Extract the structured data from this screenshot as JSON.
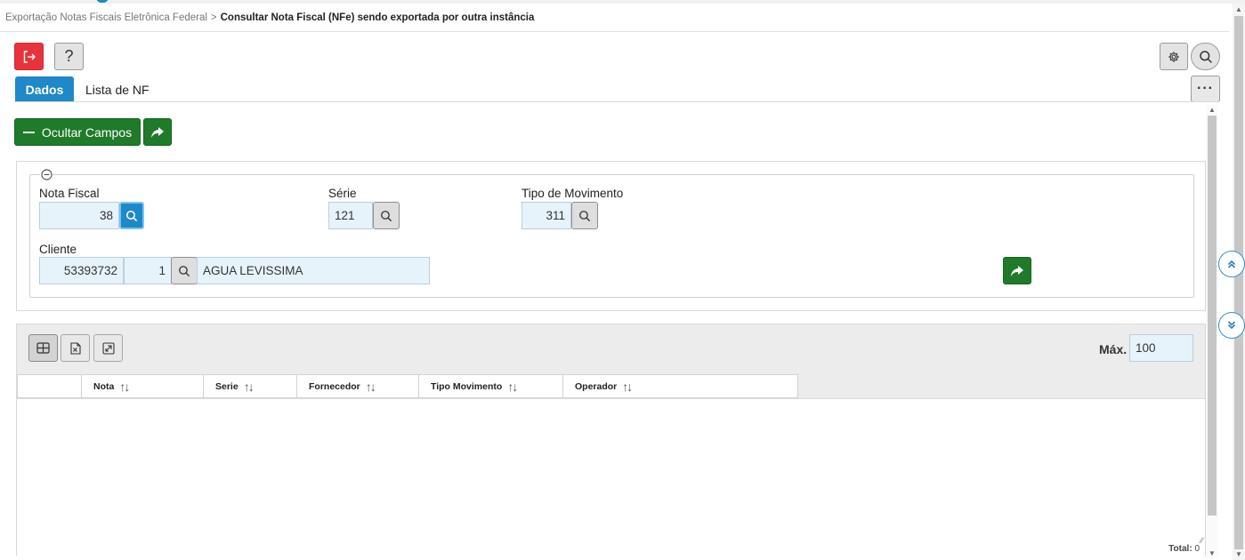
{
  "breadcrumb": {
    "parent": "Exportação Notas Fiscais Eletrônica Federal",
    "separator": ">",
    "current": "Consultar Nota Fiscal (NFe) sendo exportada por outra instância"
  },
  "toolbar": {
    "help_label": "?",
    "more_label": "···"
  },
  "tabs": [
    {
      "label": "Dados",
      "active": true
    },
    {
      "label": "Lista de NF",
      "active": false
    }
  ],
  "actions": {
    "ocultar_label": "Ocultar Campos"
  },
  "form": {
    "nota_fiscal": {
      "label": "Nota Fiscal",
      "value": "38"
    },
    "serie": {
      "label": "Série",
      "value": "121"
    },
    "tipo_movimento": {
      "label": "Tipo de Movimento",
      "value": "311"
    },
    "cliente": {
      "label": "Cliente",
      "code": "53393732",
      "sub": "1",
      "name": "AGUA LEVISSIMA"
    }
  },
  "grid": {
    "max_label": "Máx.",
    "max_value": "100",
    "columns": [
      {
        "label": "Nota"
      },
      {
        "label": "Serie"
      },
      {
        "label": "Fornecedor"
      },
      {
        "label": "Tipo Movimento"
      },
      {
        "label": "Operador"
      }
    ],
    "rows": [],
    "total_label": "Total:",
    "total_value": "0"
  },
  "icons": {
    "exit": "exit-icon",
    "help": "help-icon",
    "gear": "gear-icon",
    "search": "search-icon",
    "more": "more-icon",
    "share": "share-icon",
    "collapse": "collapse-icon",
    "grid": "grid-icon",
    "excel": "excel-icon",
    "expand": "expand-icon",
    "scroll_up": "double-chevron-up-icon",
    "scroll_down": "double-chevron-down-icon"
  },
  "colors": {
    "primary": "#1e88c9",
    "success": "#1f7a2a",
    "danger": "#e8333d",
    "input_bg": "#e6f3fb"
  }
}
